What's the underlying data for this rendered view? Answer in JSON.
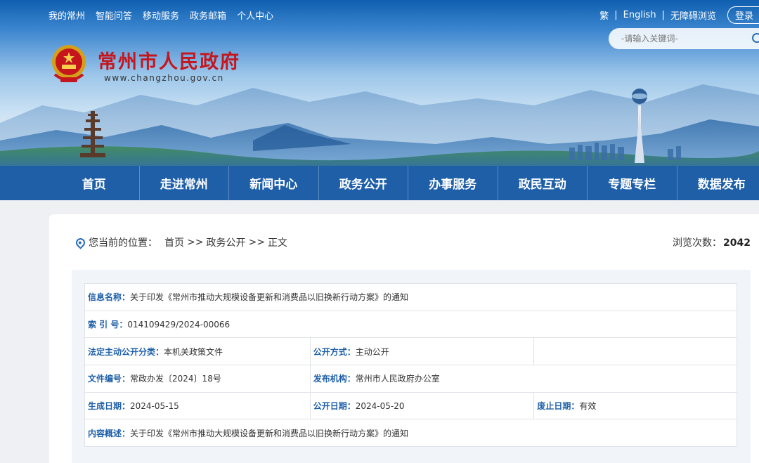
{
  "topnav": [
    "我的常州",
    "智能问答",
    "移动服务",
    "政务邮箱",
    "个人中心"
  ],
  "toplinks": {
    "traditional": "繁",
    "english": "English",
    "accessible": "无障碍浏览",
    "login": "登录"
  },
  "search": {
    "placeholder": "-请输入关键词-"
  },
  "site": {
    "title": "常州市人民政府",
    "url": "www.changzhou.gov.cn"
  },
  "mainnav": [
    "首页",
    "走进常州",
    "新闻中心",
    "政务公开",
    "办事服务",
    "政民互动",
    "专题专栏",
    "数据发布"
  ],
  "location": {
    "label": "您当前的位置：",
    "crumbs": [
      "首页",
      "政务公开",
      "正文"
    ],
    "separator": ">>"
  },
  "views": {
    "label": "浏览次数：",
    "count": "2042"
  },
  "info": {
    "name_key": "信息名称：",
    "name_val": "关于印发《常州市推动大规模设备更新和消费品以旧换新行动方案》的通知",
    "index_key": "索 引 号：",
    "index_val": "014109429/2024-00066",
    "category_key": "法定主动公开分类：",
    "category_val": "本机关政策文件",
    "method_key": "公开方式：",
    "method_val": "主动公开",
    "docno_key": "文件编号：",
    "docno_val": "常政办发〔2024〕18号",
    "issuer_key": "发布机构：",
    "issuer_val": "常州市人民政府办公室",
    "gen_date_key": "生成日期：",
    "gen_date_val": "2024-05-15",
    "pub_date_key": "公开日期：",
    "pub_date_val": "2024-05-20",
    "expire_key": "废止日期：",
    "expire_val": "有效",
    "summary_key": "内容概述：",
    "summary_val": "关于印发《常州市推动大规模设备更新和消费品以旧换新行动方案》的通知"
  }
}
